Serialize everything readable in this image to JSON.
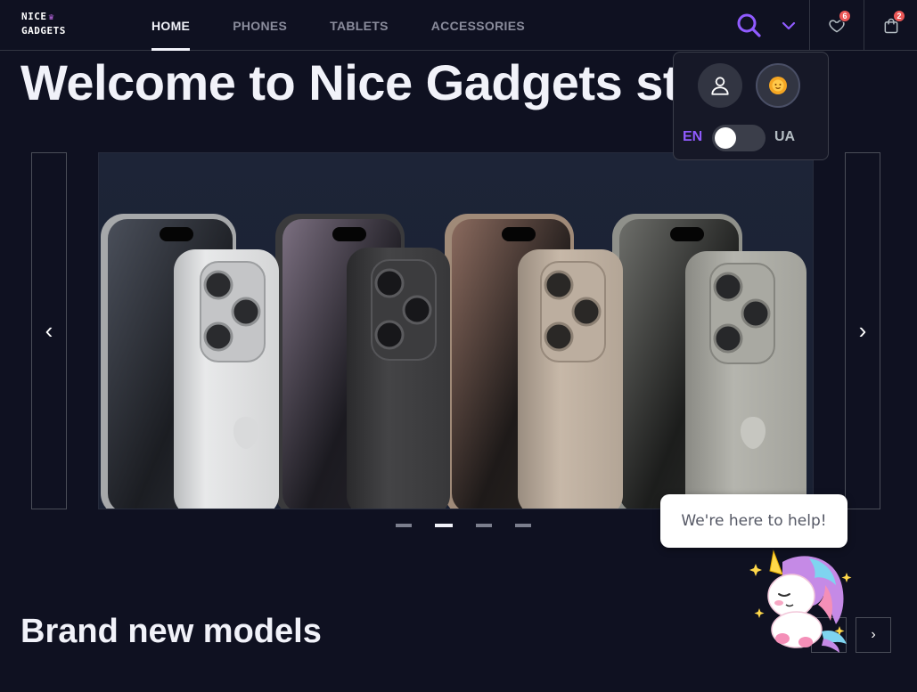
{
  "header": {
    "logo_line1": "NICE",
    "logo_line2": "GADGETS",
    "nav": [
      {
        "label": "HOME",
        "active": true
      },
      {
        "label": "PHONES",
        "active": false
      },
      {
        "label": "TABLETS",
        "active": false
      },
      {
        "label": "ACCESSORIES",
        "active": false
      }
    ],
    "favorites_count": "6",
    "cart_count": "2",
    "icons": [
      "search-icon",
      "chevron-down-icon",
      "heart-icon",
      "shopping-bag-icon"
    ]
  },
  "hero": {
    "title": "Welcome to Nice Gadgets store!",
    "prev_label": "‹",
    "next_label": "›",
    "slides_total": 4,
    "active_slide": 2
  },
  "account_menu": {
    "lang_en": "EN",
    "lang_ua": "UA",
    "toggle_state": "EN",
    "icons": [
      "user-icon",
      "sun-theme-icon"
    ]
  },
  "help_bubble": {
    "text": "We're here to help!"
  },
  "section": {
    "title": "Brand new models",
    "prev_label": "‹",
    "next_label": "›"
  },
  "colors": {
    "background": "#0f1121",
    "accent": "#905bff",
    "badge": "#eb5757",
    "border": "#323542"
  }
}
